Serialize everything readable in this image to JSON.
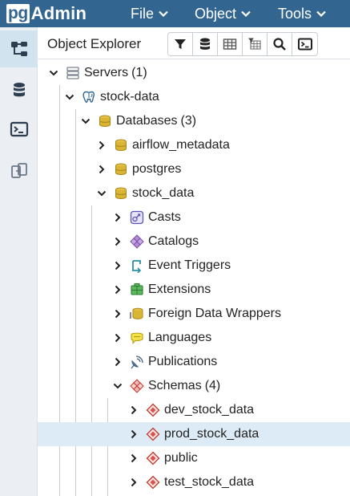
{
  "brand": {
    "prefix": "pg",
    "suffix": "Admin"
  },
  "menu": {
    "file": "File",
    "object": "Object",
    "tools": "Tools"
  },
  "sidebar": {
    "items": [
      {
        "name": "object-explorer",
        "icon": "tree-icon",
        "active": true
      },
      {
        "name": "query-tool",
        "icon": "database-icon",
        "active": false
      },
      {
        "name": "psql-tool",
        "icon": "terminal-icon",
        "active": false
      },
      {
        "name": "schema-diff",
        "icon": "compare-icon",
        "active": false
      }
    ]
  },
  "explorer": {
    "title": "Object Explorer",
    "toolbar": [
      "filter-icon",
      "database-stack-icon",
      "table-icon",
      "table-filter-icon",
      "search-icon",
      "terminal-icon"
    ]
  },
  "tree": {
    "servers": {
      "label": "Servers",
      "count": "(1)"
    },
    "server": {
      "label": "stock-data"
    },
    "databases": {
      "label": "Databases",
      "count": "(3)"
    },
    "db_airflow": {
      "label": "airflow_metadata"
    },
    "db_postgres": {
      "label": "postgres"
    },
    "db_stock": {
      "label": "stock_data"
    },
    "casts": {
      "label": "Casts"
    },
    "catalogs": {
      "label": "Catalogs"
    },
    "event_triggers": {
      "label": "Event Triggers"
    },
    "extensions": {
      "label": "Extensions"
    },
    "fdw": {
      "label": "Foreign Data Wrappers"
    },
    "languages": {
      "label": "Languages"
    },
    "publications": {
      "label": "Publications"
    },
    "schemas": {
      "label": "Schemas",
      "count": "(4)"
    },
    "schema_dev": {
      "label": "dev_stock_data"
    },
    "schema_prod": {
      "label": "prod_stock_data",
      "selected": true
    },
    "schema_public": {
      "label": "public"
    },
    "schema_test": {
      "label": "test_stock_data"
    }
  },
  "colors": {
    "navbar": "#326690",
    "selected_row": "#dcebf6",
    "sidebar": "#ebeef3",
    "db_gold": "#c9a227"
  }
}
